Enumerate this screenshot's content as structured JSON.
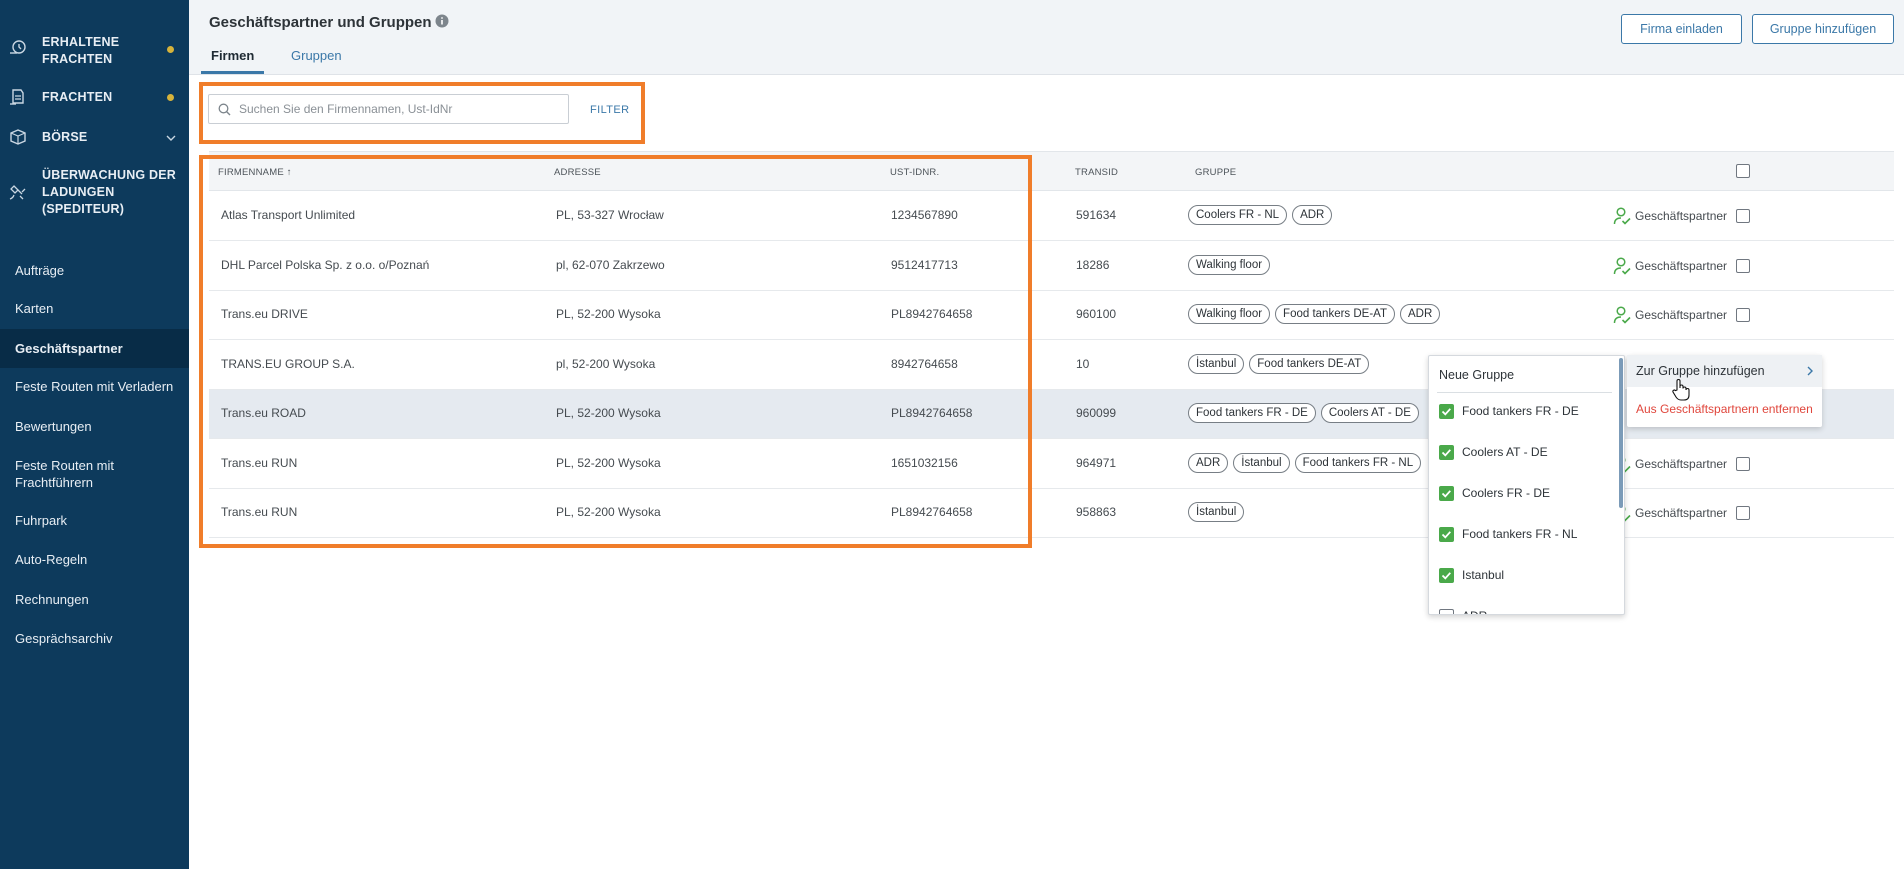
{
  "sidebar": {
    "top_items": [
      {
        "label": "ERHALTENE FRACHTEN",
        "icon": "received-freight-icon",
        "dot": true
      },
      {
        "label": "FRACHTEN",
        "icon": "freight-icon",
        "dot": true
      },
      {
        "label": "BÖRSE",
        "icon": "exchange-icon",
        "chevron": true
      },
      {
        "label": "ÜBERWACHUNG DER LADUNGEN (SPEDITEUR)",
        "icon": "satellite-icon"
      }
    ],
    "links": [
      {
        "label": "Aufträge"
      },
      {
        "label": "Karten"
      },
      {
        "label": "Geschäftspartner",
        "active": true
      },
      {
        "label": "Feste Routen mit Verladern"
      },
      {
        "label": "Bewertungen"
      },
      {
        "label": "Feste Routen mit Frachtführern"
      },
      {
        "label": "Fuhrpark"
      },
      {
        "label": "Auto-Regeln"
      },
      {
        "label": "Rechnungen"
      },
      {
        "label": "Gesprächsarchiv"
      }
    ],
    "dot_color": "#d6b33b"
  },
  "header": {
    "title": "Geschäftspartner und Gruppen",
    "tabs": [
      {
        "label": "Firmen",
        "active": true
      },
      {
        "label": "Gruppen",
        "active": false
      }
    ],
    "invite_button": "Firma einladen",
    "add_group_button": "Gruppe hinzufügen"
  },
  "search": {
    "placeholder": "Suchen Sie den Firmennamen, Ust-IdNr",
    "filter_label": "FILTER"
  },
  "table": {
    "columns": [
      "FIRMENNAME ↑",
      "ADRESSE",
      "UST-IDNR.",
      "TRANSID",
      "GRUPPE"
    ],
    "partner_label": "Geschäftspartner",
    "rows": [
      {
        "name": "Atlas Transport Unlimited",
        "address": "PL, 53-327 Wrocław",
        "vat": "1234567890",
        "transid": "591634",
        "groups": [
          "Coolers FR - NL",
          "ADR"
        ],
        "partner": true
      },
      {
        "name": "DHL Parcel Polska Sp. z o.o. o/Poznań",
        "address": "pl, 62-070 Zakrzewo",
        "vat": "9512417713",
        "transid": "18286",
        "groups": [
          "Walking floor"
        ],
        "partner": true
      },
      {
        "name": "Trans.eu DRIVE",
        "address": "PL, 52-200 Wysoka",
        "vat": "PL8942764658",
        "transid": "960100",
        "groups": [
          "Walking floor",
          "Food tankers DE-AT",
          "ADR"
        ],
        "partner": true
      },
      {
        "name": "TRANS.EU GROUP S.A.",
        "address": "pl, 52-200 Wysoka",
        "vat": "8942764658",
        "transid": "10",
        "groups": [
          "İstanbul",
          "Food tankers DE-AT"
        ],
        "partner": false
      },
      {
        "name": "Trans.eu ROAD",
        "address": "PL, 52-200 Wysoka",
        "vat": "PL8942764658",
        "transid": "960099",
        "groups": [
          "Food tankers FR - DE",
          "Coolers AT - DE"
        ],
        "partner": false,
        "hover": true
      },
      {
        "name": "Trans.eu RUN",
        "address": "PL, 52-200 Wysoka",
        "vat": "1651032156",
        "transid": "964971",
        "groups": [
          "ADR",
          "İstanbul",
          "Food tankers FR - NL"
        ],
        "partner": true
      },
      {
        "name": "Trans.eu RUN",
        "address": "PL, 52-200 Wysoka",
        "vat": "PL8942764658",
        "transid": "958863",
        "groups": [
          "İstanbul"
        ],
        "partner": true
      }
    ]
  },
  "group_dropdown": {
    "new_group": "Neue Gruppe",
    "options": [
      {
        "label": "Food tankers FR - DE",
        "checked": true
      },
      {
        "label": "Coolers AT - DE",
        "checked": true
      },
      {
        "label": "Coolers FR - DE",
        "checked": true
      },
      {
        "label": "Food tankers FR - NL",
        "checked": true
      },
      {
        "label": "Istanbul",
        "checked": true
      },
      {
        "label": "ADR",
        "checked": false
      }
    ]
  },
  "context_menu": {
    "add_to_group": "Zur Gruppe hinzufügen",
    "remove_partner": "Aus Geschäftspartnern entfernen"
  },
  "colors": {
    "sidebar_bg": "#0d3a5c",
    "accent": "#3b78a8",
    "highlight": "#f07d2a",
    "check_green": "#4aa94a",
    "danger": "#e0463c"
  }
}
